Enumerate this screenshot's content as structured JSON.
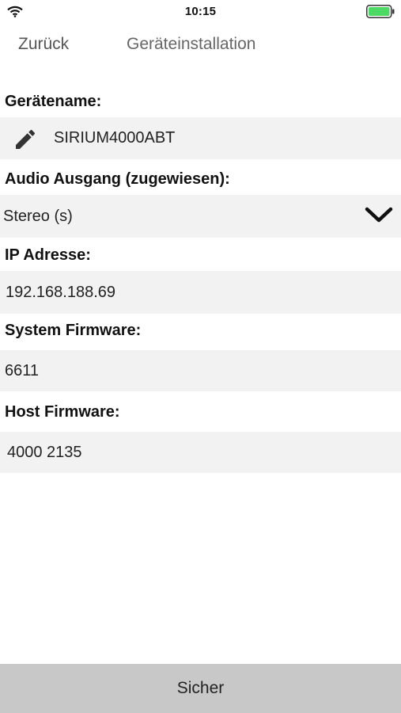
{
  "status_bar": {
    "time": "10:15",
    "icons": [
      "wifi-icon",
      "battery-icon"
    ],
    "battery_color": "#4cd964"
  },
  "nav": {
    "back_label": "Zurück",
    "title": "Geräteinstallation"
  },
  "fields": {
    "device_name": {
      "label": "Gerätename:",
      "value": "SIRIUM4000ABT",
      "icon": "pencil-icon"
    },
    "audio_output": {
      "label": "Audio Ausgang (zugewiesen):",
      "value": "Stereo (s)",
      "icon": "chevron-down-icon"
    },
    "ip_address": {
      "label": "IP Adresse:",
      "value": "192.168.188.69"
    },
    "system_firmware": {
      "label": "System Firmware:",
      "value": "6611"
    },
    "host_firmware": {
      "label": "Host Firmware:",
      "value": "4000 2135"
    }
  },
  "footer": {
    "save_label": "Sicher"
  },
  "colors": {
    "field_background": "#f2f2f2",
    "footer_background": "#c8c8c8"
  }
}
